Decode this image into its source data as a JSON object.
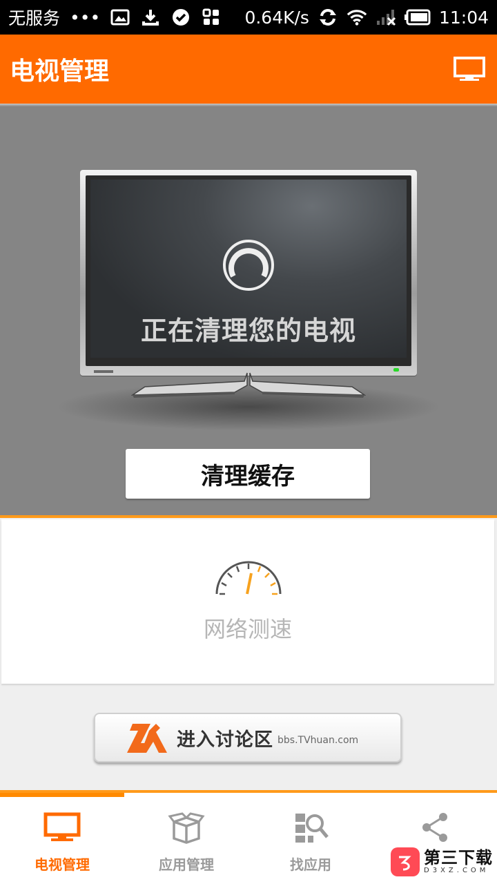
{
  "status_bar": {
    "carrier": "无服务",
    "dots": "•••",
    "net_speed": "0.64K/s",
    "time": "11:04",
    "icons": [
      "image-icon",
      "download-icon",
      "check-circle-icon",
      "apps-icon",
      "sync-icon",
      "wifi-icon",
      "signal-off-icon",
      "battery-icon"
    ]
  },
  "app_bar": {
    "title": "电视管理",
    "action_icon": "tv-icon"
  },
  "hero": {
    "status_text": "正在清理您的电视",
    "button_label": "清理缓存"
  },
  "speed_test": {
    "label": "网络测速"
  },
  "forum_banner": {
    "title": "进入讨论区",
    "url": "bbs.TVhuan.com"
  },
  "bottom_nav": {
    "items": [
      {
        "label": "电视管理",
        "icon": "tv-icon",
        "active": true
      },
      {
        "label": "应用管理",
        "icon": "box-icon",
        "active": false
      },
      {
        "label": "找应用",
        "icon": "search-apps-icon",
        "active": false
      },
      {
        "label": "",
        "icon": "share-icon",
        "active": false
      }
    ]
  },
  "watermark": {
    "cn": "第三下载",
    "en": "D3XZ.COM"
  },
  "colors": {
    "accent": "#ff6a00",
    "accent_line": "#ff9a1a",
    "hero_bg": "#858585"
  }
}
